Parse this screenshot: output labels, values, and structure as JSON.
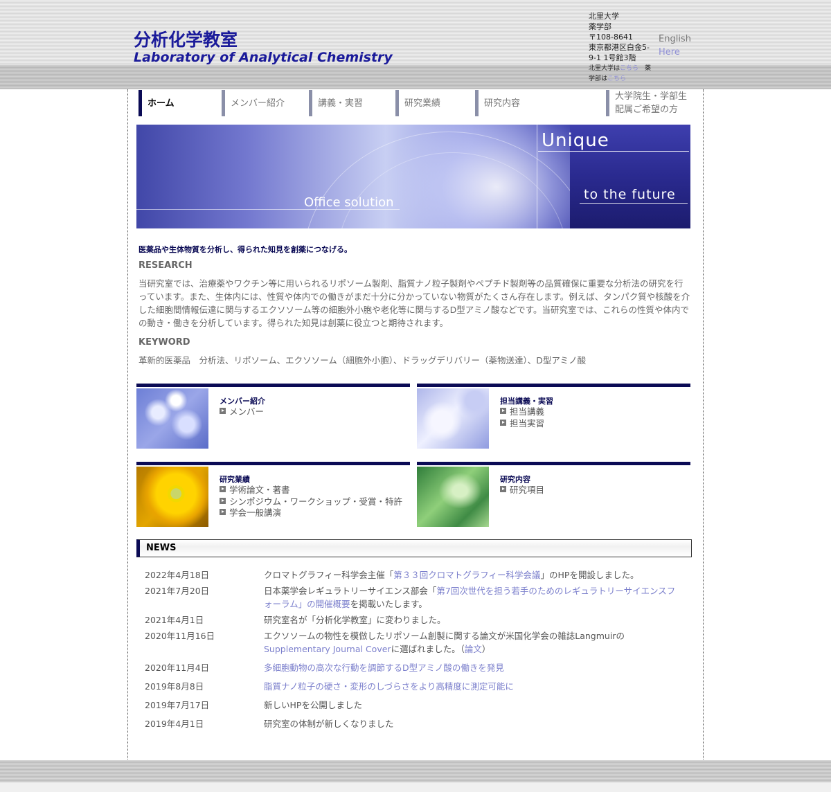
{
  "header": {
    "title": "分析化学教室",
    "subtitle": "Laboratory of Analytical Chemistry",
    "address": [
      "北里大学",
      "薬学部",
      "〒108-8641",
      "東京都港区白金5-",
      "9-1 1号館3階"
    ],
    "university_link_prefix": "北里大学は",
    "university_link": "こちら",
    "faculty_link_prefix_a": "薬",
    "faculty_link_prefix_b": "学部は",
    "faculty_link": "こちら",
    "lang_label": "English",
    "lang_link": "Here"
  },
  "nav": {
    "items": [
      "ホーム",
      "メンバー紹介",
      "講義・実習",
      "研究業績",
      "研究内容"
    ],
    "last_line1": "大学院生・学部生",
    "last_line2": "配属ご希望の方"
  },
  "banner": {
    "text1": "Unique",
    "text2": "to the future",
    "text3": "Office solution"
  },
  "intro": {
    "tagline": "医薬品や生体物質を分析し、得られた知見を創薬につなげる。",
    "research_head": "RESEARCH",
    "research_text": "当研究室では、治療薬やワクチン等に用いられるリポソーム製剤、脂質ナノ粒子製剤やペプチド製剤等の品質確保に重要な分析法の研究を行っています。また、生体内には、性質や体内での働きがまだ十分に分かっていない物質がたくさん存在します。例えば、タンパク質や核酸を介した細胞間情報伝達に関与するエクソソーム等の細胞外小胞や老化等に関与するD型アミノ酸などです。当研究室では、これらの性質や体内での動き・働きを分析しています。得られた知見は創薬に役立つと期待されます。",
    "keyword_head": "KEYWORD",
    "keyword_text": "革新的医薬品　分析法、リポソーム、エクソソーム（細胞外小胞）、ドラッグデリバリー（薬物送達）、D型アミノ酸"
  },
  "cards": [
    {
      "title": "メンバー紹介",
      "items": [
        "メンバー"
      ]
    },
    {
      "title": "担当講義・実習",
      "items": [
        "担当講義",
        "担当実習"
      ]
    },
    {
      "title": "研究業績",
      "items": [
        "学術論文・著書",
        "シンポジウム・ワークショップ・受賞・特許",
        "学会一般講演"
      ]
    },
    {
      "title": "研究内容",
      "items": [
        "研究項目"
      ]
    }
  ],
  "news": {
    "head": "NEWS",
    "rows": [
      {
        "date": "2022年4月18日",
        "pre": "クロマトグラフィー科学会主催「",
        "link": "第３３回クロマトグラフィー科学会議",
        "post": "」のHPを開設しました。"
      },
      {
        "date": "2021年7月20日",
        "pre": " 日本薬学会レギュラトリーサイエンス部会「",
        "link": "第7回次世代を担う若手のためのレギュラトリーサイエンスフォーラム」の開催概要",
        "post": "を掲載いたします。"
      },
      {
        "date": "2021年4月1日",
        "pre": "研究室名が「分析化学教室」に変わりました。",
        "link": "",
        "post": ""
      },
      {
        "date": "2020年11月16日",
        "pre": "エクソソームの物性を模倣したリポソーム創製に関する論文が米国化学会の雑誌Langmuirの",
        "link": "Supplementary Journal Cover",
        "post": "に選ばれました。（",
        "link2": "論文",
        "post2": "）"
      },
      {
        "date": "2020年11月4日",
        "pre": "",
        "link": "多細胞動物の高次な行動を調節するD型アミノ酸の働きを発見",
        "post": ""
      },
      {
        "date": "2019年8月8日",
        "pre": "",
        "link": "脂質ナノ粒子の硬さ・変形のしづらさをより高精度に測定可能に",
        "post": ""
      },
      {
        "date": "2019年7月17日",
        "pre": "新しいHPを公開しました",
        "link": "",
        "post": ""
      },
      {
        "date": "2019年4月1日",
        "pre": "研究室の体制が新しくなりました",
        "link": "",
        "post": ""
      }
    ]
  },
  "colors": {
    "navy": "#0b0b55",
    "title_blue": "#1a1a9a",
    "link": "#7b7fcc"
  }
}
